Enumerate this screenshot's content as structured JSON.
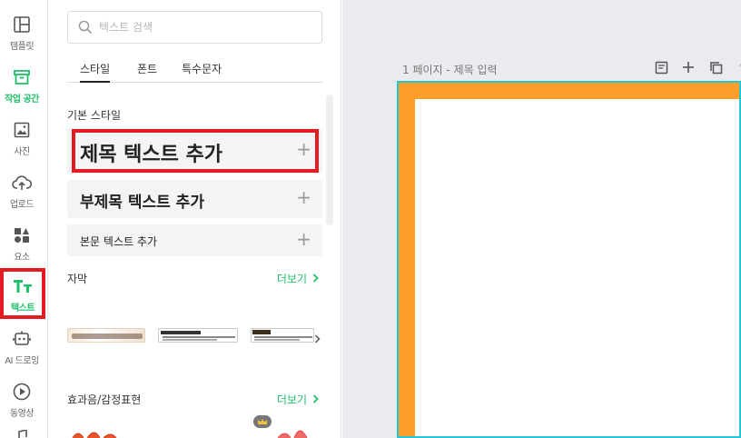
{
  "rail": {
    "items": [
      {
        "label": "템플릿",
        "icon": "template-icon"
      },
      {
        "label": "작업 공간",
        "icon": "workspace-box-icon"
      },
      {
        "label": "사진",
        "icon": "photo-icon"
      },
      {
        "label": "업로드",
        "icon": "upload-cloud-icon"
      },
      {
        "label": "요소",
        "icon": "elements-shapes-icon"
      },
      {
        "label": "텍스트",
        "icon": "text-tt-icon"
      },
      {
        "label": "AI 드로잉",
        "icon": "ai-robot-icon"
      },
      {
        "label": "동영상",
        "icon": "video-play-icon"
      }
    ],
    "active_color": "#1fbf6b",
    "highlight_color": "#e31b23"
  },
  "panel": {
    "search": {
      "placeholder": "텍스트 검색"
    },
    "tabs": [
      {
        "label": "스타일"
      },
      {
        "label": "폰트"
      },
      {
        "label": "특수문자"
      }
    ],
    "basic_styles": {
      "title": "기본 스타일",
      "items": [
        {
          "label": "제목 텍스트 추가"
        },
        {
          "label": "부제목 텍스트 추가"
        },
        {
          "label": "본문 텍스트 추가"
        }
      ]
    },
    "subtitles": {
      "title": "자막",
      "more": "더보기"
    },
    "sfx": {
      "title": "효과음/감정표현",
      "more": "더보기"
    }
  },
  "workspace": {
    "page_label": "1 페이지 - 제목 입력",
    "page_color": "#ff9e2a",
    "selection_color": "#27c6d6"
  }
}
